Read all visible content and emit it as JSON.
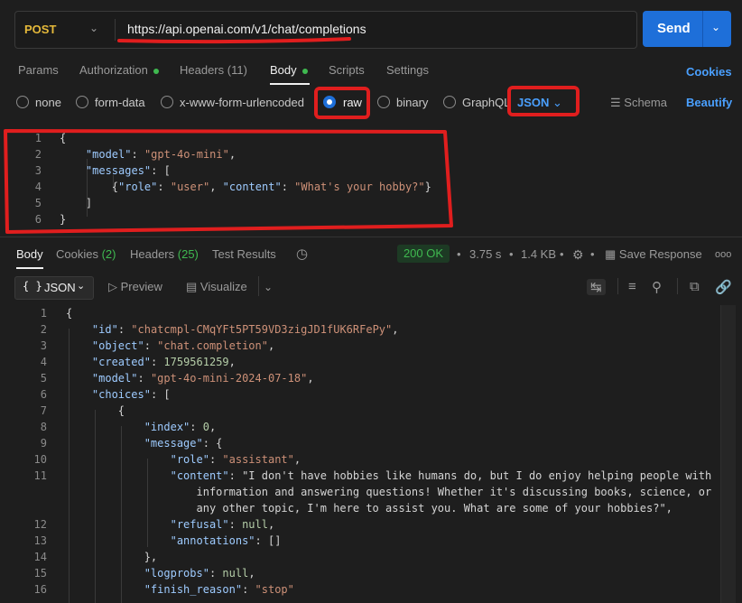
{
  "request": {
    "method": "POST",
    "url": "https://api.openai.com/v1/chat/completions",
    "send_label": "Send"
  },
  "tabs": [
    {
      "label": "Params"
    },
    {
      "label": "Authorization"
    },
    {
      "label": "Headers (11)"
    },
    {
      "label": "Body"
    },
    {
      "label": "Scripts"
    },
    {
      "label": "Settings"
    }
  ],
  "cookies_label": "Cookies",
  "body_types": [
    {
      "label": "none"
    },
    {
      "label": "form-data"
    },
    {
      "label": "x-www-form-urlencoded"
    },
    {
      "label": "raw",
      "selected": true
    },
    {
      "label": "binary"
    },
    {
      "label": "GraphQL"
    }
  ],
  "body_format": "JSON",
  "schema_label": "Schema",
  "beautify_label": "Beautify",
  "request_body_lines": [
    {
      "num": "1",
      "text": "{"
    },
    {
      "num": "2",
      "text": "    \"model\": \"gpt-4o-mini\","
    },
    {
      "num": "3",
      "text": "    \"messages\": ["
    },
    {
      "num": "4",
      "text": "        {\"role\": \"user\", \"content\": \"What's your hobby?\"}"
    },
    {
      "num": "5",
      "text": "    ]"
    },
    {
      "num": "6",
      "text": "}"
    }
  ],
  "response_tabs": [
    {
      "label": "Body"
    },
    {
      "label": "Cookies",
      "count": "(2)"
    },
    {
      "label": "Headers",
      "count": "(25)"
    },
    {
      "label": "Test Results"
    }
  ],
  "response_meta": {
    "status": "200 OK",
    "time": "3.75 s",
    "size": "1.4 KB",
    "save_label": "Save Response",
    "more": "ooo"
  },
  "response_toolbar": {
    "format": "JSON",
    "preview": "Preview",
    "visualize": "Visualize"
  },
  "response_lines": [
    {
      "num": "1",
      "text": "{"
    },
    {
      "num": "2",
      "text": "    \"id\": \"chatcmpl-CMqYFt5PT59VD3zigJD1fUK6RFePy\","
    },
    {
      "num": "3",
      "text": "    \"object\": \"chat.completion\","
    },
    {
      "num": "4",
      "text": "    \"created\": 1759561259,"
    },
    {
      "num": "5",
      "text": "    \"model\": \"gpt-4o-mini-2024-07-18\","
    },
    {
      "num": "6",
      "text": "    \"choices\": ["
    },
    {
      "num": "7",
      "text": "        {"
    },
    {
      "num": "8",
      "text": "            \"index\": 0,"
    },
    {
      "num": "9",
      "text": "            \"message\": {"
    },
    {
      "num": "10",
      "text": "                \"role\": \"assistant\","
    },
    {
      "num": "11",
      "text": "                \"content\": \"I don't have hobbies like humans do, but I do enjoy helping people with"
    },
    {
      "num": "",
      "text": "                    information and answering questions! Whether it's discussing books, science, or"
    },
    {
      "num": "",
      "text": "                    any other topic, I'm here to assist you. What are some of your hobbies?\","
    },
    {
      "num": "12",
      "text": "                \"refusal\": null,"
    },
    {
      "num": "13",
      "text": "                \"annotations\": []"
    },
    {
      "num": "14",
      "text": "            },"
    },
    {
      "num": "15",
      "text": "            \"logprobs\": null,"
    },
    {
      "num": "16",
      "text": "            \"finish_reason\": \"stop\""
    }
  ],
  "colors": {
    "accent": "#1e6fd9",
    "method": "#e5b93a",
    "status_ok": "#3fb950",
    "json_key": "#9ecbff",
    "json_string": "#ce9178",
    "json_number": "#b5cea8",
    "annotation_red": "#e01e1e"
  }
}
